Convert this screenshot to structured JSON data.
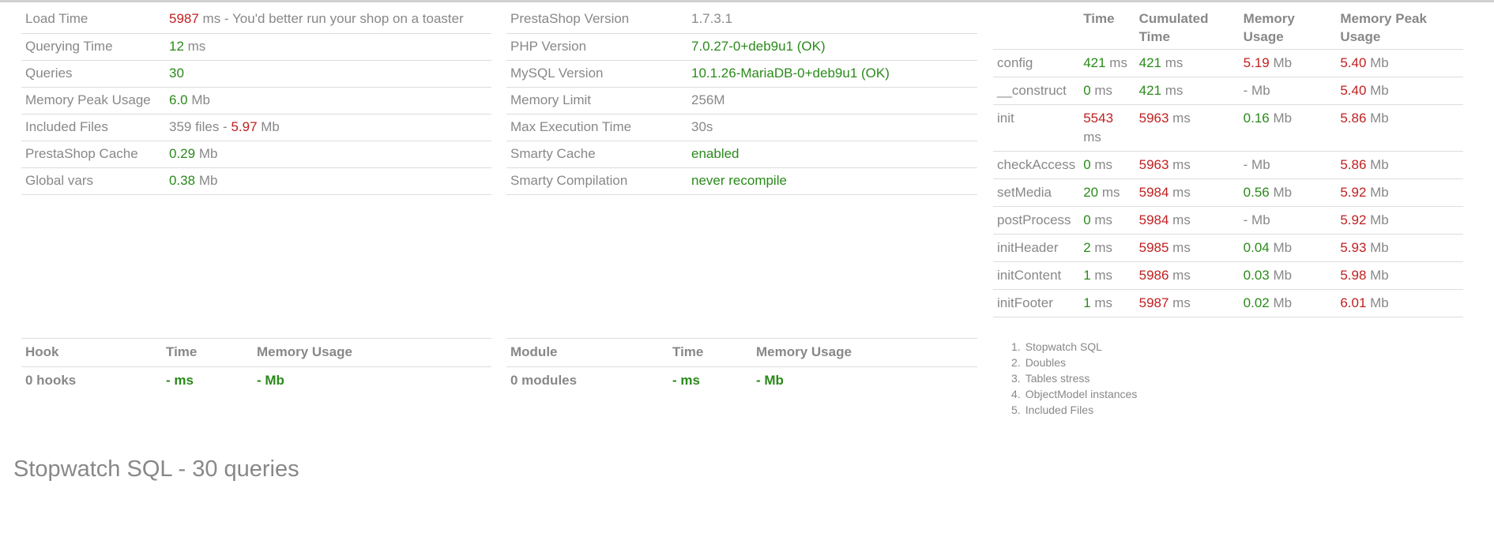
{
  "summary_left": [
    {
      "label": "Load Time",
      "parts": [
        {
          "t": "5987",
          "c": "bad"
        },
        {
          "t": " ms - You'd better run your shop on a toaster",
          "c": "grey"
        }
      ]
    },
    {
      "label": "Querying Time",
      "parts": [
        {
          "t": "12",
          "c": "ok"
        },
        {
          "t": " ms",
          "c": "grey"
        }
      ]
    },
    {
      "label": "Queries",
      "parts": [
        {
          "t": "30",
          "c": "ok"
        }
      ]
    },
    {
      "label": "Memory Peak Usage",
      "parts": [
        {
          "t": "6.0",
          "c": "ok"
        },
        {
          "t": " Mb",
          "c": "grey"
        }
      ]
    },
    {
      "label": "Included Files",
      "parts": [
        {
          "t": "359 files - ",
          "c": "grey"
        },
        {
          "t": "5.97",
          "c": "bad"
        },
        {
          "t": " Mb",
          "c": "grey"
        }
      ]
    },
    {
      "label": "PrestaShop Cache",
      "parts": [
        {
          "t": "0.29",
          "c": "ok"
        },
        {
          "t": " Mb",
          "c": "grey"
        }
      ]
    },
    {
      "label": "Global vars",
      "parts": [
        {
          "t": "0.38",
          "c": "ok"
        },
        {
          "t": " Mb",
          "c": "grey"
        }
      ]
    }
  ],
  "summary_right": [
    {
      "label": "PrestaShop Version",
      "parts": [
        {
          "t": "1.7.3.1",
          "c": "grey"
        }
      ]
    },
    {
      "label": "PHP Version",
      "parts": [
        {
          "t": "7.0.27-0+deb9u1 (OK)",
          "c": "ok"
        }
      ]
    },
    {
      "label": "MySQL Version",
      "parts": [
        {
          "t": "10.1.26-MariaDB-0+deb9u1 (OK)",
          "c": "ok"
        }
      ]
    },
    {
      "label": "Memory Limit",
      "parts": [
        {
          "t": "256M",
          "c": "grey"
        }
      ]
    },
    {
      "label": "Max Execution Time",
      "parts": [
        {
          "t": "30s",
          "c": "grey"
        }
      ]
    },
    {
      "label": "Smarty Cache",
      "parts": [
        {
          "t": "enabled",
          "c": "ok"
        }
      ]
    },
    {
      "label": "Smarty Compilation",
      "parts": [
        {
          "t": "never recompile",
          "c": "ok"
        }
      ]
    }
  ],
  "controller": {
    "headers": [
      "",
      "Time",
      "Cumulated Time",
      "Memory Usage",
      "Memory Peak Usage"
    ],
    "rows": [
      {
        "name": "config",
        "time": [
          "421",
          "ok",
          " ms"
        ],
        "cum": [
          "421",
          "ok",
          " ms"
        ],
        "mem": [
          "5.19",
          "bad",
          " Mb"
        ],
        "peak": [
          "5.40",
          "bad",
          " Mb"
        ]
      },
      {
        "name": "__construct",
        "time": [
          "0",
          "ok",
          " ms"
        ],
        "cum": [
          "421",
          "ok",
          " ms"
        ],
        "mem": [
          "-",
          "grey",
          " Mb"
        ],
        "peak": [
          "5.40",
          "bad",
          " Mb"
        ]
      },
      {
        "name": "init",
        "time": [
          "5543",
          "bad",
          " ms"
        ],
        "cum": [
          "5963",
          "bad",
          " ms"
        ],
        "mem": [
          "0.16",
          "ok",
          " Mb"
        ],
        "peak": [
          "5.86",
          "bad",
          " Mb"
        ]
      },
      {
        "name": "checkAccess",
        "time": [
          "0",
          "ok",
          " ms"
        ],
        "cum": [
          "5963",
          "bad",
          " ms"
        ],
        "mem": [
          "-",
          "grey",
          " Mb"
        ],
        "peak": [
          "5.86",
          "bad",
          " Mb"
        ]
      },
      {
        "name": "setMedia",
        "time": [
          "20",
          "ok",
          " ms"
        ],
        "cum": [
          "5984",
          "bad",
          " ms"
        ],
        "mem": [
          "0.56",
          "ok",
          " Mb"
        ],
        "peak": [
          "5.92",
          "bad",
          " Mb"
        ]
      },
      {
        "name": "postProcess",
        "time": [
          "0",
          "ok",
          " ms"
        ],
        "cum": [
          "5984",
          "bad",
          " ms"
        ],
        "mem": [
          "-",
          "grey",
          " Mb"
        ],
        "peak": [
          "5.92",
          "bad",
          " Mb"
        ]
      },
      {
        "name": "initHeader",
        "time": [
          "2",
          "ok",
          " ms"
        ],
        "cum": [
          "5985",
          "bad",
          " ms"
        ],
        "mem": [
          "0.04",
          "ok",
          " Mb"
        ],
        "peak": [
          "5.93",
          "bad",
          " Mb"
        ]
      },
      {
        "name": "initContent",
        "time": [
          "1",
          "ok",
          " ms"
        ],
        "cum": [
          "5986",
          "bad",
          " ms"
        ],
        "mem": [
          "0.03",
          "ok",
          " Mb"
        ],
        "peak": [
          "5.98",
          "bad",
          " Mb"
        ]
      },
      {
        "name": "initFooter",
        "time": [
          "1",
          "ok",
          " ms"
        ],
        "cum": [
          "5987",
          "bad",
          " ms"
        ],
        "mem": [
          "0.02",
          "ok",
          " Mb"
        ],
        "peak": [
          "6.01",
          "bad",
          " Mb"
        ]
      }
    ]
  },
  "hooks": {
    "headers": [
      "Hook",
      "Time",
      "Memory Usage"
    ],
    "row": {
      "name": "0 hooks",
      "time": "- ms",
      "mem": "- Mb"
    }
  },
  "modules": {
    "headers": [
      "Module",
      "Time",
      "Memory Usage"
    ],
    "row": {
      "name": "0 modules",
      "time": "- ms",
      "mem": "- Mb"
    }
  },
  "toc": [
    {
      "num": "1.",
      "label": "Stopwatch SQL"
    },
    {
      "num": "2.",
      "label": "Doubles"
    },
    {
      "num": "3.",
      "label": "Tables stress"
    },
    {
      "num": "4.",
      "label": "ObjectModel instances"
    },
    {
      "num": "5.",
      "label": "Included Files"
    }
  ],
  "stopwatch_title": "Stopwatch SQL - 30 queries",
  "colors": {
    "ok": "#2a8a1a",
    "bad": "#c02020",
    "text": "#888888",
    "border": "#dddddd"
  }
}
